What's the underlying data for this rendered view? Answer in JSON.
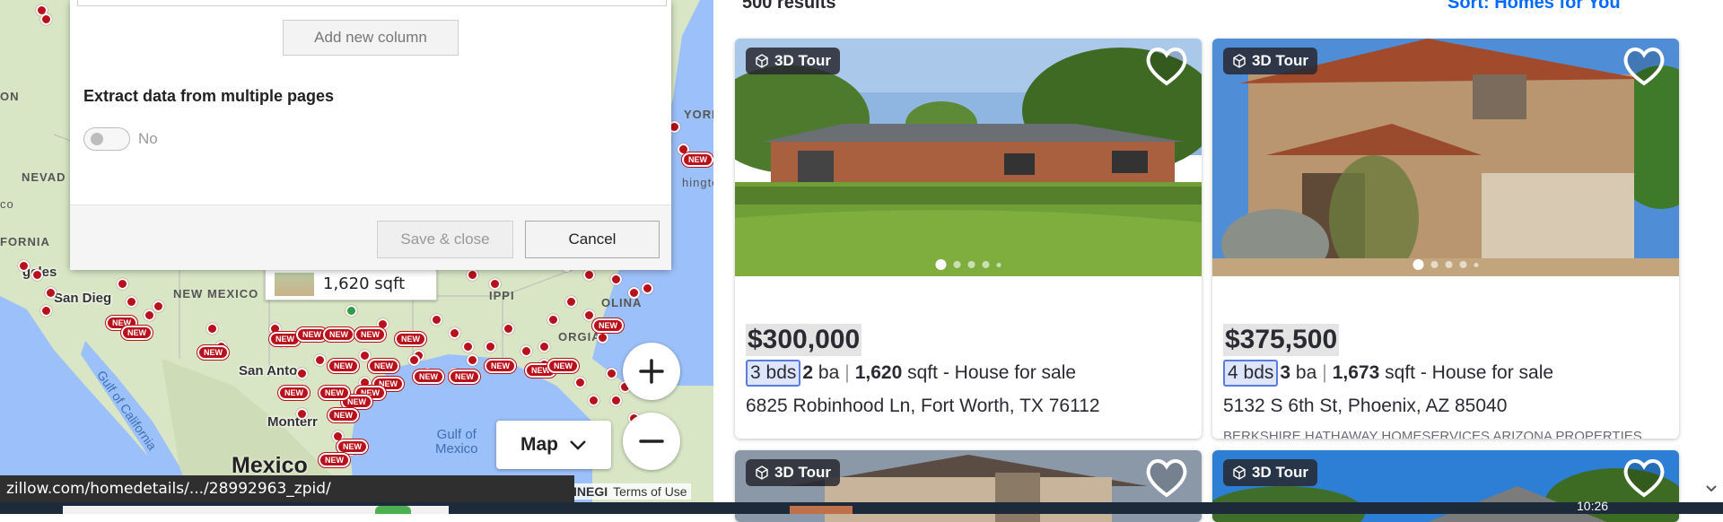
{
  "map": {
    "labels": {
      "nevada": "NEVAD",
      "california": "FORNIA",
      "co": "co",
      "on": "ON",
      "new_mexico": "NEW MEXICO",
      "los_angeles": "geles",
      "san_diego": "San Dieg",
      "york": "YORK",
      "hington": "hington",
      "ippi": "IPPI",
      "olina": "OLINA",
      "orgia": "ORGIA",
      "san_antonio": "San Anto",
      "monterrey": "Monterr",
      "mexico": "Mexico",
      "gulf_of_mexico_line1": "Gulf of",
      "gulf_of_mexico_line2": "Mexico",
      "gulf_of_california": "Gulf of California",
      "new_badge": "NEW"
    },
    "hover_tooltip": "1,620 sqft",
    "map_type_button": "Map",
    "attribution_left": "INEGI",
    "attribution_terms": "Terms of Use"
  },
  "dialog": {
    "add_column_button": "Add new column",
    "extract_label": "Extract data from multiple pages",
    "toggle_label": "No",
    "save_close_button": "Save & close",
    "cancel_button": "Cancel"
  },
  "status_url": "zillow.com/homedetails/.../28992963_zpid/",
  "listings": {
    "results_partial": "500 results",
    "sort_partial": "Sort: Homes for You",
    "cards": [
      {
        "badge": "3D Tour",
        "price": "$300,000",
        "beds": "3 bds",
        "baths_num": "2",
        "baths_unit": "ba",
        "sqft_num": "1,620",
        "sqft_unit": "sqft",
        "type": "- House for sale",
        "address": "6825 Robinhood Ln, Fort Worth, TX 76112"
      },
      {
        "badge": "3D Tour",
        "price": "$375,500",
        "beds": "4 bds",
        "baths_num": "3",
        "baths_unit": "ba",
        "sqft_num": "1,673",
        "sqft_unit": "sqft",
        "type": "- House for sale",
        "address": "5132 S 6th St, Phoenix, AZ 85040",
        "broker": "BERKSHIRE HATHAWAY HOMESERVICES ARIZONA PROPERTIES. Listing provided by ARMLS"
      },
      {
        "badge": "3D Tour"
      },
      {
        "badge": "3D Tour"
      }
    ]
  },
  "taskbar": {
    "time_partial": "10:26"
  },
  "colors": {
    "marker": "#b8111b",
    "link": "#006aff",
    "water": "#9cc0f9",
    "land": "#d7e4c8"
  }
}
